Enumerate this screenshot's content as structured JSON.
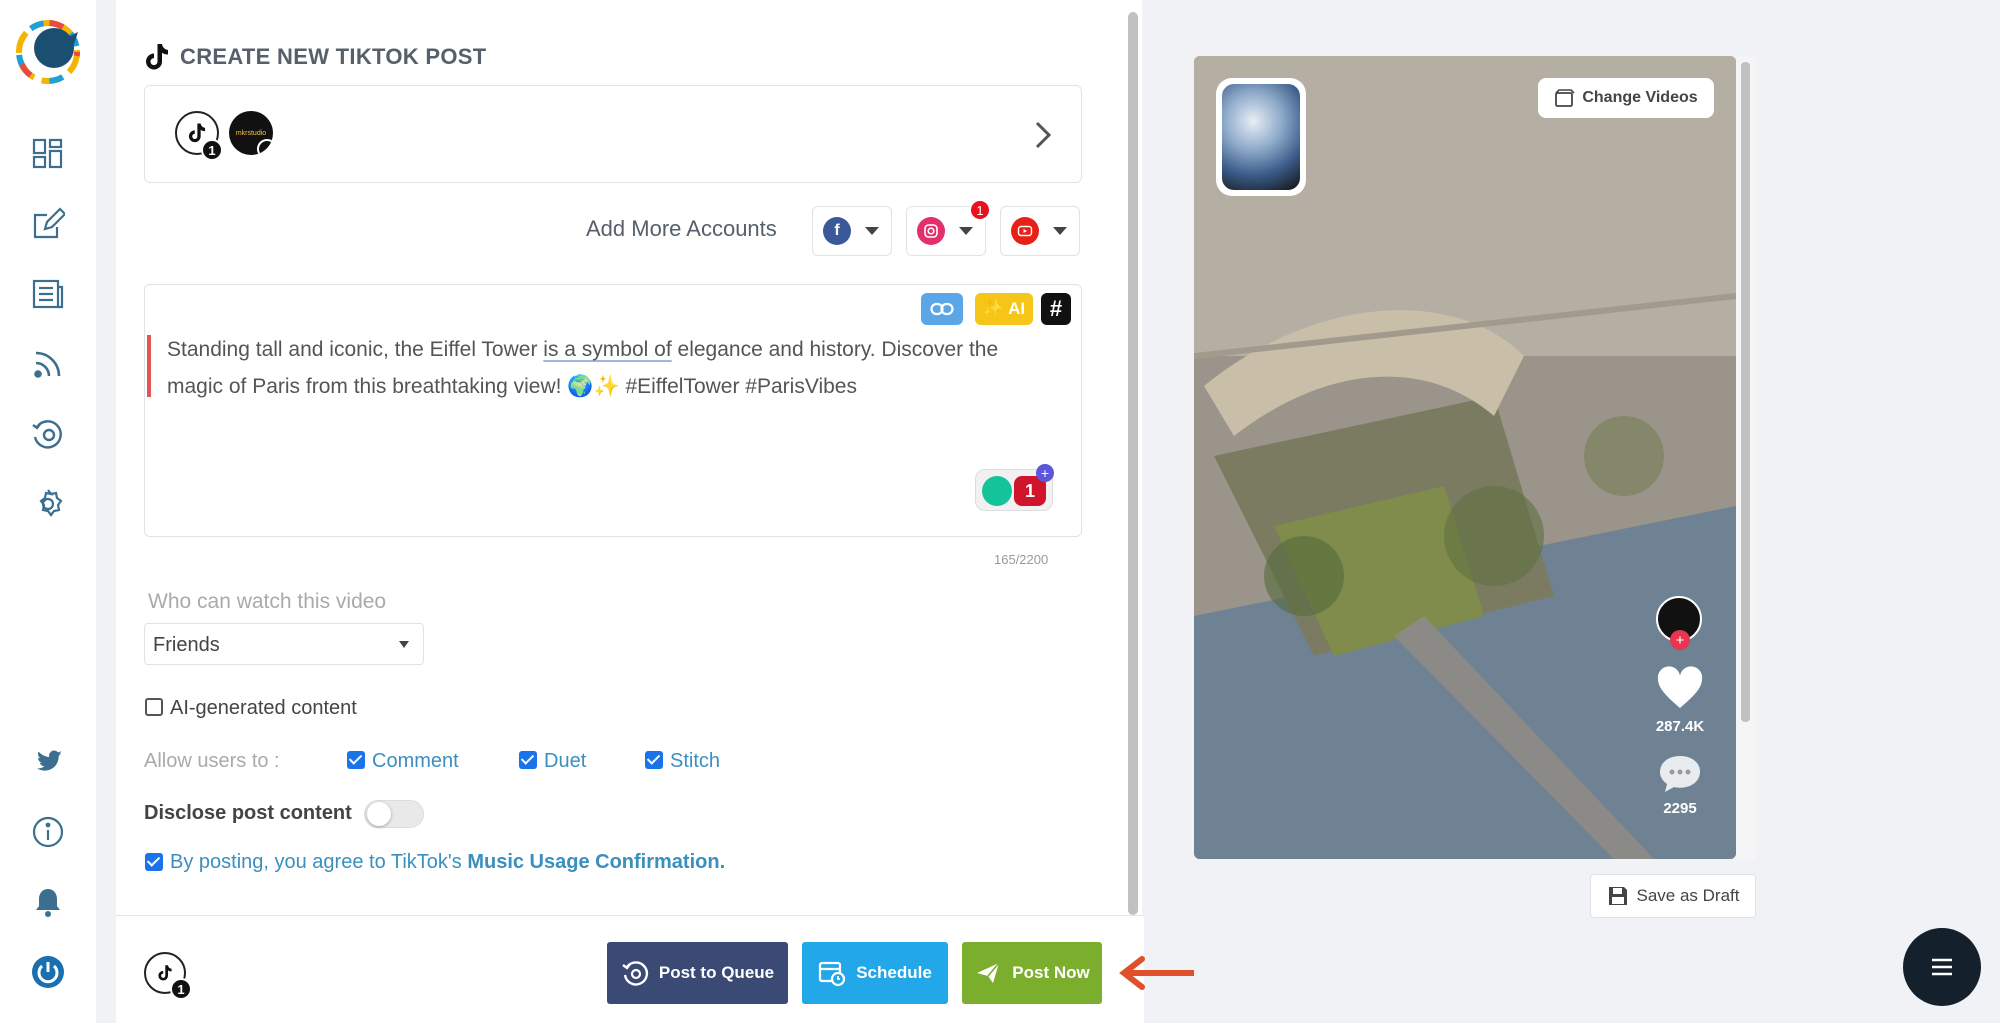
{
  "page": {
    "title": "CREATE NEW TIKTOK POST"
  },
  "sidebar": {
    "icons": [
      "dashboard-icon",
      "compose-icon",
      "posts-icon",
      "rss-icon",
      "queue-icon",
      "settings-icon",
      "twitter-icon",
      "info-icon",
      "bell-icon",
      "power-icon"
    ]
  },
  "accounts": {
    "tiktok_badge": "1",
    "brand_text": "mkrstudio"
  },
  "add_more": {
    "label": "Add More Accounts",
    "instagram_badge": "1"
  },
  "editor": {
    "text_before": "Standing tall and iconic, the Eiffel Tower ",
    "text_underlined": "is a symbol of",
    "text_after": " elegance and history. Discover the magic of Paris from this breathtaking view! 🌍✨ #EiffelTower #ParisVibes",
    "ai_label": "AI",
    "hash_label": "#",
    "grammar_count": "1",
    "char_count": "165/2200"
  },
  "privacy": {
    "label": "Who can watch this video",
    "selected": "Friends"
  },
  "ai_generated": {
    "label": "AI-generated content",
    "checked": false
  },
  "allow": {
    "label": "Allow users to :",
    "options": [
      "Comment",
      "Duet",
      "Stitch"
    ]
  },
  "disclose": {
    "label": "Disclose post content",
    "on": false
  },
  "music": {
    "prefix": "By posting, you agree to TikTok's ",
    "link": "Music Usage Confirmation."
  },
  "footer": {
    "tiktok_badge": "1",
    "queue_label": "Post to Queue",
    "schedule_label": "Schedule",
    "post_now_label": "Post Now"
  },
  "preview": {
    "change_videos": "Change Videos",
    "likes": "287.4K",
    "comments": "2295",
    "save_draft": "Save as Draft"
  },
  "colors": {
    "queue": "#3b4a74",
    "schedule": "#22a7e8",
    "post_now": "#7cae2e",
    "link_blue": "#3b8fbf",
    "arrow": "#e0502a"
  }
}
